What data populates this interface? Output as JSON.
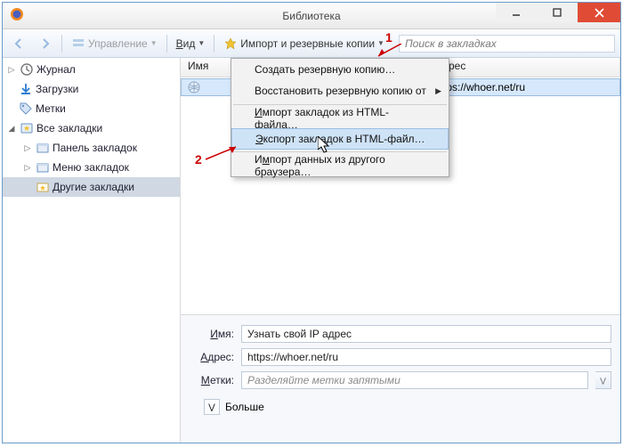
{
  "window": {
    "title": "Библиотека"
  },
  "toolbar": {
    "manage": "Управление",
    "view": "Вид",
    "import": "Импорт и резервные копии",
    "search_placeholder": "Поиск в закладках"
  },
  "sidebar": {
    "items": [
      {
        "label": "Журнал"
      },
      {
        "label": "Загрузки"
      },
      {
        "label": "Метки"
      },
      {
        "label": "Все закладки"
      },
      {
        "label": "Панель закладок"
      },
      {
        "label": "Меню закладок"
      },
      {
        "label": "Другие закладки"
      }
    ]
  },
  "list": {
    "header": {
      "name": "Имя",
      "address": "Адрес"
    },
    "row": {
      "name": "",
      "address": "https://whoer.net/ru"
    }
  },
  "menu": {
    "items": [
      "Создать резервную копию…",
      "Восстановить резервную копию от",
      "Импорт закладок из HTML-файла…",
      "Экспорт закладок в HTML-файл…",
      "Импорт данных из другого браузера…"
    ]
  },
  "details": {
    "labels": {
      "name": "Имя:",
      "address": "Адрес:",
      "tags": "Метки:",
      "more": "Больше"
    },
    "name": "Узнать свой IP адрес",
    "address": "https://whoer.net/ru",
    "tags_placeholder": "Разделяйте метки запятыми"
  },
  "annotations": {
    "one": "1",
    "two": "2"
  }
}
